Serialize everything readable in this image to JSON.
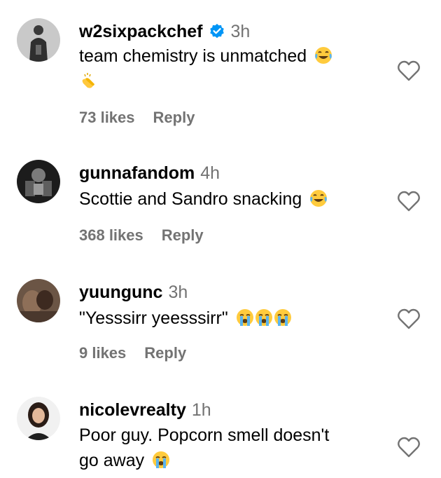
{
  "comments": [
    {
      "username": "w2sixpackchef",
      "verified": true,
      "time": "3h",
      "text": "team chemistry is unmatched",
      "emojis": [
        "face-with-tears-of-joy",
        "clapping-hands"
      ],
      "likes": "73 likes",
      "reply": "Reply"
    },
    {
      "username": "gunnafandom",
      "verified": false,
      "time": "4h",
      "text": "Scottie and Sandro snacking",
      "emojis": [
        "face-with-tears-of-joy"
      ],
      "likes": "368 likes",
      "reply": "Reply"
    },
    {
      "username": "yuungunc",
      "verified": false,
      "time": "3h",
      "text": "\"Yesssirr yeesssirr\"",
      "emojis": [
        "loudly-crying-face",
        "loudly-crying-face",
        "loudly-crying-face"
      ],
      "likes": "9 likes",
      "reply": "Reply"
    },
    {
      "username": "nicolevrealty",
      "verified": false,
      "time": "1h",
      "text_line1": "Poor guy. Popcorn smell doesn't",
      "text_line2": "go away",
      "emojis": [
        "loudly-crying-face"
      ]
    }
  ],
  "colors": {
    "text": "#000000",
    "secondary": "#737373",
    "verified_badge": "#0095F6"
  }
}
